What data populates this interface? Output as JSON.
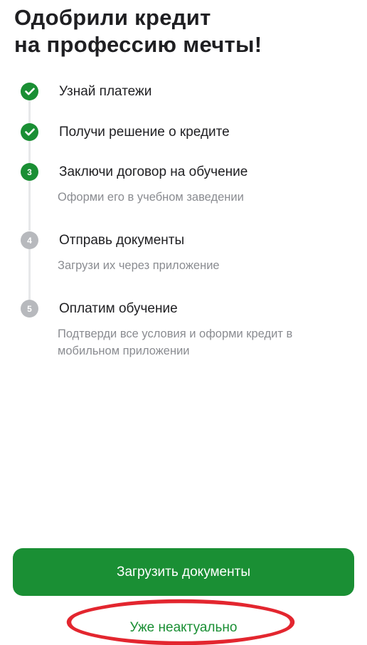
{
  "header": {
    "title_line1": "Одобрили кредит",
    "title_line2": "на профессию мечты!"
  },
  "steps": [
    {
      "status": "done",
      "icon": "check-icon",
      "title": "Узнай платежи"
    },
    {
      "status": "done",
      "icon": "check-icon",
      "title": "Получи решение о кредите"
    },
    {
      "status": "active",
      "number": "3",
      "title": "Заключи договор на обучение",
      "subtitle": "Оформи его в учебном заведении"
    },
    {
      "status": "pending",
      "number": "4",
      "title": "Отправь документы",
      "subtitle": "Загрузи их через приложение"
    },
    {
      "status": "pending",
      "number": "5",
      "title": "Оплатим обучение",
      "subtitle": "Подтверди все условия и оформи кредит в мобильном приложении"
    }
  ],
  "actions": {
    "primary_label": "Загрузить документы",
    "secondary_label": "Уже неактуально"
  },
  "colors": {
    "accent": "#1a8f34",
    "pending": "#b7b9bd",
    "line": "#e7e8ea",
    "annotation": "#e3262f"
  }
}
